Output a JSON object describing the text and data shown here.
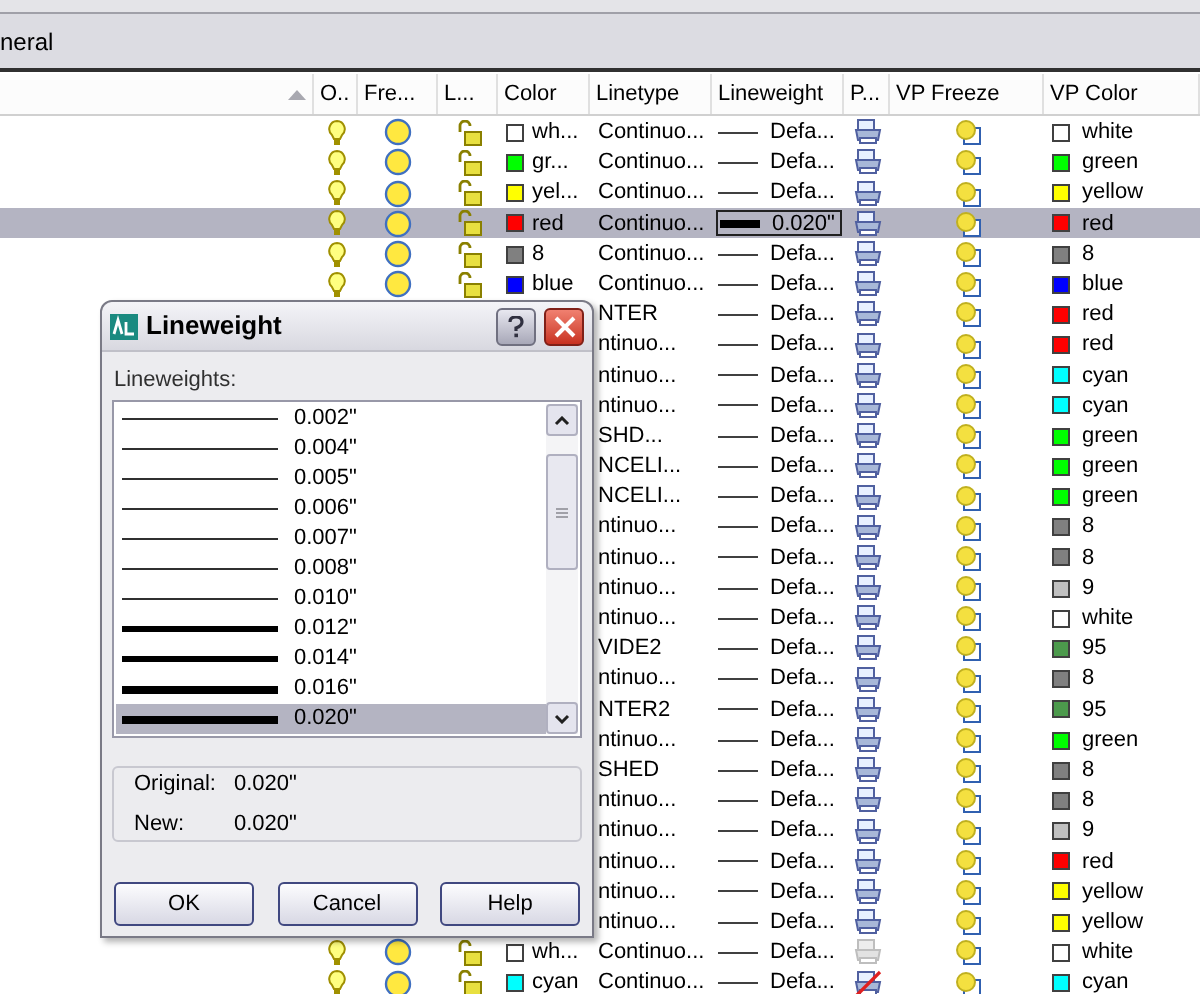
{
  "tab_strip": {
    "label": "neral"
  },
  "table": {
    "columns": [
      "",
      "O..",
      "Fre...",
      "L...",
      "Color",
      "Linetype",
      "Lineweight",
      "P...",
      "VP Freeze",
      "VP Color"
    ],
    "rows": [
      {
        "selected": false,
        "on": true,
        "frozen": false,
        "locked": false,
        "layer_color": {
          "color": "#ffffff",
          "name": "wh..."
        },
        "linetype": "Continuo...",
        "lineweight": {
          "value": "Defa...",
          "kind": "thin"
        },
        "plot": {
          "kind": "on"
        },
        "vp_color": {
          "color": "#ffffff",
          "name": "white"
        }
      },
      {
        "selected": false,
        "on": true,
        "frozen": false,
        "locked": false,
        "layer_color": {
          "color": "#00ff00",
          "name": "gr..."
        },
        "linetype": "Continuo...",
        "lineweight": {
          "value": "Defa...",
          "kind": "thin"
        },
        "plot": {
          "kind": "on"
        },
        "vp_color": {
          "color": "#00ff00",
          "name": "green"
        }
      },
      {
        "selected": false,
        "on": true,
        "frozen": false,
        "locked": false,
        "layer_color": {
          "color": "#ffff00",
          "name": "yel..."
        },
        "linetype": "Continuo...",
        "lineweight": {
          "value": "Defa...",
          "kind": "thin"
        },
        "plot": {
          "kind": "on"
        },
        "vp_color": {
          "color": "#ffff00",
          "name": "yellow"
        }
      },
      {
        "selected": true,
        "on": true,
        "frozen": false,
        "locked": false,
        "layer_color": {
          "color": "#ff0000",
          "name": "red"
        },
        "linetype": "Continuo...",
        "lineweight": {
          "value": "0.020\"",
          "kind": "heavy"
        },
        "plot": {
          "kind": "on"
        },
        "vp_color": {
          "color": "#ff0000",
          "name": "red"
        }
      },
      {
        "selected": false,
        "on": true,
        "frozen": false,
        "locked": false,
        "layer_color": {
          "color": "#808080",
          "name": "8"
        },
        "linetype": "Continuo...",
        "lineweight": {
          "value": "Defa...",
          "kind": "thin"
        },
        "plot": {
          "kind": "on"
        },
        "vp_color": {
          "color": "#808080",
          "name": "8"
        }
      },
      {
        "selected": false,
        "on": true,
        "frozen": false,
        "locked": false,
        "layer_color": {
          "color": "#0000ff",
          "name": "blue"
        },
        "linetype": "Continuo...",
        "lineweight": {
          "value": "Defa...",
          "kind": "thin"
        },
        "plot": {
          "kind": "on"
        },
        "vp_color": {
          "color": "#0000ff",
          "name": "blue"
        }
      },
      {
        "selected": false,
        "linetype": "NTER",
        "lineweight": {
          "value": "Defa...",
          "kind": "thin"
        },
        "plot": {
          "kind": "on"
        },
        "vp_color": {
          "color": "#ff0000",
          "name": "red"
        }
      },
      {
        "selected": false,
        "linetype": "ntinuo...",
        "lineweight": {
          "value": "Defa...",
          "kind": "thin"
        },
        "plot": {
          "kind": "on"
        },
        "vp_color": {
          "color": "#ff0000",
          "name": "red"
        }
      },
      {
        "selected": false,
        "linetype": "ntinuo...",
        "lineweight": {
          "value": "Defa...",
          "kind": "thin"
        },
        "plot": {
          "kind": "on"
        },
        "vp_color": {
          "color": "#00ffff",
          "name": "cyan"
        }
      },
      {
        "selected": false,
        "linetype": "ntinuo...",
        "lineweight": {
          "value": "Defa...",
          "kind": "thin"
        },
        "plot": {
          "kind": "on"
        },
        "vp_color": {
          "color": "#00ffff",
          "name": "cyan"
        }
      },
      {
        "selected": false,
        "linetype": "SHD...",
        "lineweight": {
          "value": "Defa...",
          "kind": "thin"
        },
        "plot": {
          "kind": "on"
        },
        "vp_color": {
          "color": "#00ff00",
          "name": "green"
        }
      },
      {
        "selected": false,
        "linetype": "NCELI...",
        "lineweight": {
          "value": "Defa...",
          "kind": "thin"
        },
        "plot": {
          "kind": "on"
        },
        "vp_color": {
          "color": "#00ff00",
          "name": "green"
        }
      },
      {
        "selected": false,
        "linetype": "NCELI...",
        "lineweight": {
          "value": "Defa...",
          "kind": "thin"
        },
        "plot": {
          "kind": "on"
        },
        "vp_color": {
          "color": "#00ff00",
          "name": "green"
        }
      },
      {
        "selected": false,
        "linetype": "ntinuo...",
        "lineweight": {
          "value": "Defa...",
          "kind": "thin"
        },
        "plot": {
          "kind": "on"
        },
        "vp_color": {
          "color": "#808080",
          "name": "8"
        }
      },
      {
        "selected": false,
        "linetype": "ntinuo...",
        "lineweight": {
          "value": "Defa...",
          "kind": "thin"
        },
        "plot": {
          "kind": "on"
        },
        "vp_color": {
          "color": "#808080",
          "name": "8"
        }
      },
      {
        "selected": false,
        "linetype": "ntinuo...",
        "lineweight": {
          "value": "Defa...",
          "kind": "thin"
        },
        "plot": {
          "kind": "on"
        },
        "vp_color": {
          "color": "#c0c0c0",
          "name": "9"
        }
      },
      {
        "selected": false,
        "linetype": "ntinuo...",
        "lineweight": {
          "value": "Defa...",
          "kind": "thin"
        },
        "plot": {
          "kind": "on"
        },
        "vp_color": {
          "color": "#ffffff",
          "name": "white"
        }
      },
      {
        "selected": false,
        "linetype": "VIDE2",
        "lineweight": {
          "value": "Defa...",
          "kind": "thin"
        },
        "plot": {
          "kind": "on"
        },
        "vp_color": {
          "color": "#4c9a4c",
          "name": "95"
        }
      },
      {
        "selected": false,
        "linetype": "ntinuo...",
        "lineweight": {
          "value": "Defa...",
          "kind": "thin"
        },
        "plot": {
          "kind": "on"
        },
        "vp_color": {
          "color": "#808080",
          "name": "8"
        }
      },
      {
        "selected": false,
        "linetype": "NTER2",
        "lineweight": {
          "value": "Defa...",
          "kind": "thin"
        },
        "plot": {
          "kind": "on"
        },
        "vp_color": {
          "color": "#4c9a4c",
          "name": "95"
        }
      },
      {
        "selected": false,
        "linetype": "ntinuo...",
        "lineweight": {
          "value": "Defa...",
          "kind": "thin"
        },
        "plot": {
          "kind": "on"
        },
        "vp_color": {
          "color": "#00ff00",
          "name": "green"
        }
      },
      {
        "selected": false,
        "linetype": "SHED",
        "lineweight": {
          "value": "Defa...",
          "kind": "thin"
        },
        "plot": {
          "kind": "on"
        },
        "vp_color": {
          "color": "#808080",
          "name": "8"
        }
      },
      {
        "selected": false,
        "linetype": "ntinuo...",
        "lineweight": {
          "value": "Defa...",
          "kind": "thin"
        },
        "plot": {
          "kind": "on"
        },
        "vp_color": {
          "color": "#808080",
          "name": "8"
        }
      },
      {
        "selected": false,
        "linetype": "ntinuo...",
        "lineweight": {
          "value": "Defa...",
          "kind": "thin"
        },
        "plot": {
          "kind": "on"
        },
        "vp_color": {
          "color": "#c0c0c0",
          "name": "9"
        }
      },
      {
        "selected": false,
        "linetype": "ntinuo...",
        "lineweight": {
          "value": "Defa...",
          "kind": "thin"
        },
        "plot": {
          "kind": "on"
        },
        "vp_color": {
          "color": "#ff0000",
          "name": "red"
        }
      },
      {
        "selected": false,
        "linetype": "ntinuo...",
        "lineweight": {
          "value": "Defa...",
          "kind": "thin"
        },
        "plot": {
          "kind": "on"
        },
        "vp_color": {
          "color": "#ffff00",
          "name": "yellow"
        }
      },
      {
        "selected": false,
        "linetype": "ntinuo...",
        "lineweight": {
          "value": "Defa...",
          "kind": "thin"
        },
        "plot": {
          "kind": "on"
        },
        "vp_color": {
          "color": "#ffff00",
          "name": "yellow"
        }
      },
      {
        "selected": false,
        "on": true,
        "frozen": false,
        "locked": false,
        "layer_color": {
          "color": "#ffffff",
          "name": "wh..."
        },
        "linetype": "Continuo...",
        "lineweight": {
          "value": "Defa...",
          "kind": "thin"
        },
        "plot": {
          "kind": "disabled"
        },
        "vp_color": {
          "color": "#ffffff",
          "name": "white"
        }
      },
      {
        "selected": false,
        "on": true,
        "frozen": false,
        "locked": false,
        "layer_color": {
          "color": "#00ffff",
          "name": "cyan"
        },
        "linetype": "Continuo...",
        "lineweight": {
          "value": "Defa...",
          "kind": "thin"
        },
        "plot": {
          "kind": "off"
        },
        "vp_color": {
          "color": "#00ffff",
          "name": "cyan"
        }
      }
    ]
  },
  "dialog": {
    "title": "Lineweight",
    "list_label": "Lineweights:",
    "items": [
      {
        "label": "0.002\"",
        "kind": "thin",
        "selected": false
      },
      {
        "label": "0.004\"",
        "kind": "thin",
        "selected": false
      },
      {
        "label": "0.005\"",
        "kind": "thin",
        "selected": false
      },
      {
        "label": "0.006\"",
        "kind": "thin",
        "selected": false
      },
      {
        "label": "0.007\"",
        "kind": "thin",
        "selected": false
      },
      {
        "label": "0.008\"",
        "kind": "thin",
        "selected": false
      },
      {
        "label": "0.010\"",
        "kind": "thin",
        "selected": false
      },
      {
        "label": "0.012\"",
        "kind": "bold",
        "selected": false
      },
      {
        "label": "0.014\"",
        "kind": "bold",
        "selected": false
      },
      {
        "label": "0.016\"",
        "kind": "heavy",
        "selected": false
      },
      {
        "label": "0.020\"",
        "kind": "heavy",
        "selected": true
      }
    ],
    "original_label": "Original:",
    "original_value": "0.020\"",
    "new_label": "New:",
    "new_value": "0.020\"",
    "buttons": [
      "OK",
      "Cancel",
      "Help"
    ]
  }
}
